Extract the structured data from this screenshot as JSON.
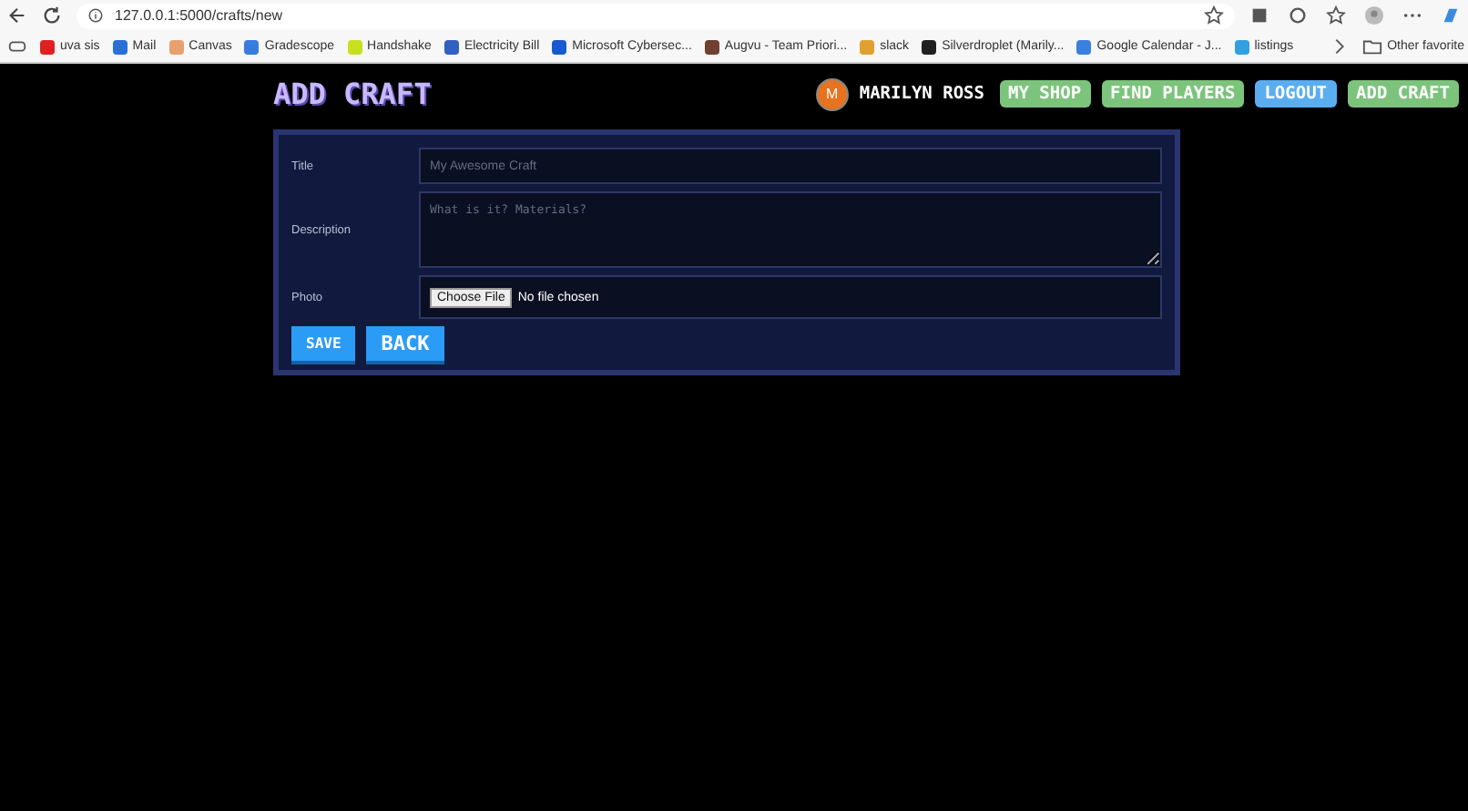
{
  "browser": {
    "url": "127.0.0.1:5000/crafts/new",
    "bookmarks": [
      {
        "label": "uva sis",
        "color": "#e02020"
      },
      {
        "label": "Mail",
        "color": "#2a6fd6"
      },
      {
        "label": "Canvas",
        "color": "#e8a070"
      },
      {
        "label": "Gradescope",
        "color": "#3a7be0"
      },
      {
        "label": "Handshake",
        "color": "#c8e020"
      },
      {
        "label": "Electricity Bill",
        "color": "#3060c0"
      },
      {
        "label": "Microsoft Cybersec...",
        "color": "#1a5ad0"
      },
      {
        "label": "Augvu - Team Priori...",
        "color": "#704030"
      },
      {
        "label": "slack",
        "color": "#e0a030"
      },
      {
        "label": "Silverdroplet (Marily...",
        "color": "#202020"
      },
      {
        "label": "Google Calendar - J...",
        "color": "#3a80e0"
      },
      {
        "label": "listings",
        "color": "#30a0e0"
      }
    ],
    "other_favorites": "Other favorite"
  },
  "page": {
    "title": "ADD CRAFT",
    "user": {
      "initial": "M",
      "name": "MARILYN ROSS"
    },
    "nav": [
      {
        "label": "MY SHOP",
        "color": "#7cc47c"
      },
      {
        "label": "FIND PLAYERS",
        "color": "#7cc47c"
      },
      {
        "label": "LOGOUT",
        "color": "#5aaef0"
      },
      {
        "label": "ADD CRAFT",
        "color": "#7cc47c"
      }
    ],
    "form": {
      "fields": [
        {
          "kind": "text",
          "label": "Title",
          "placeholder": "My Awesome Craft"
        },
        {
          "kind": "textarea",
          "label": "Description",
          "placeholder": "What is it? Materials?"
        },
        {
          "kind": "file",
          "label": "Photo",
          "button": "Choose File",
          "value": "No file chosen"
        }
      ],
      "buttons": [
        "SAVE",
        "BACK"
      ]
    }
  }
}
